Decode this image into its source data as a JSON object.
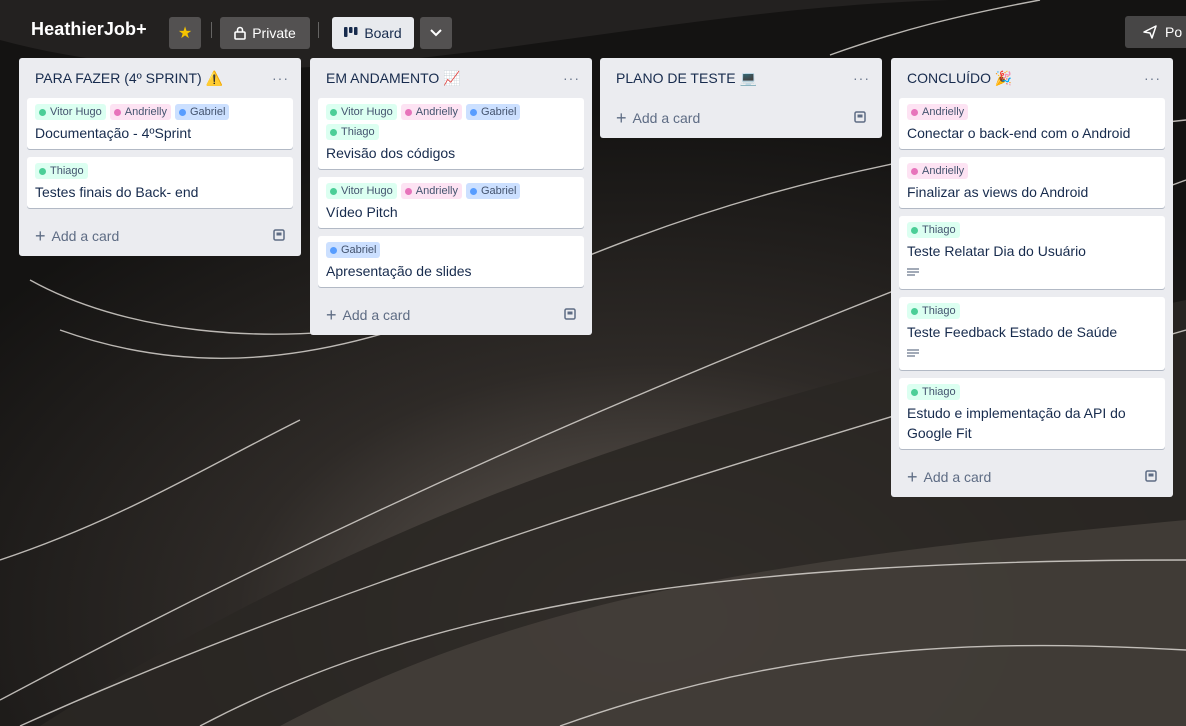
{
  "board": {
    "title": "HeathierJob+",
    "visibility": "Private",
    "view": "Board",
    "right_button": "Po"
  },
  "colors": {
    "green_label": "#4bce97",
    "purple_label": "#e774bb",
    "blue_label": "#579dff",
    "list_bg": "#ebecf0"
  },
  "lists": [
    {
      "title": "PARA FAZER (4º SPRINT) ⚠️",
      "add_label": "Add a card",
      "cards": [
        {
          "labels": [
            "Vitor Hugo",
            "Andrielly",
            "Gabriel"
          ],
          "title": "Documentação - 4ºSprint",
          "has_desc": false
        },
        {
          "labels": [
            "Thiago"
          ],
          "title": "Testes finais do Back- end",
          "has_desc": false
        }
      ]
    },
    {
      "title": "EM ANDAMENTO 📈",
      "add_label": "Add a card",
      "cards": [
        {
          "labels": [
            "Vitor Hugo",
            "Andrielly",
            "Gabriel",
            "Thiago"
          ],
          "title": "Revisão dos códigos",
          "has_desc": false
        },
        {
          "labels": [
            "Vitor Hugo",
            "Andrielly",
            "Gabriel"
          ],
          "title": "Vídeo Pitch",
          "has_desc": false
        },
        {
          "labels": [
            "Gabriel"
          ],
          "title": "Apresentação de slides",
          "has_desc": false
        }
      ]
    },
    {
      "title": "PLANO DE TESTE 💻",
      "add_label": "Add a card",
      "cards": []
    },
    {
      "title": "CONCLUÍDO 🎉",
      "add_label": "Add a card",
      "cards": [
        {
          "labels": [
            "Andrielly"
          ],
          "title": "Conectar o back-end com o Android",
          "has_desc": false
        },
        {
          "labels": [
            "Andrielly"
          ],
          "title": "Finalizar as views do Android",
          "has_desc": false
        },
        {
          "labels": [
            "Thiago"
          ],
          "title": "Teste Relatar Dia do Usuário",
          "has_desc": true
        },
        {
          "labels": [
            "Thiago"
          ],
          "title": "Teste Feedback Estado de Saúde",
          "has_desc": true
        },
        {
          "labels": [
            "Thiago"
          ],
          "title": "Estudo e implementação da API do Google Fit",
          "has_desc": false
        }
      ]
    }
  ]
}
